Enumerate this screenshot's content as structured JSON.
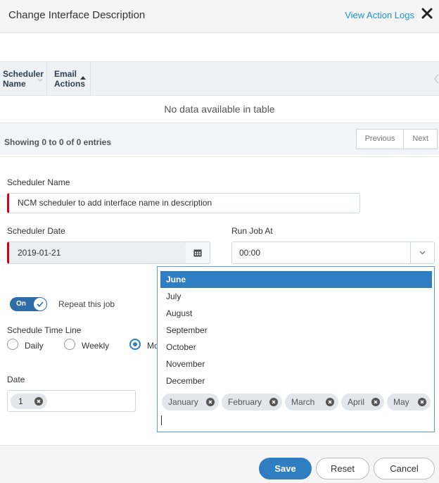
{
  "header": {
    "title": "Change Interface Description",
    "view_logs": "View Action Logs"
  },
  "table": {
    "columns": [
      {
        "line1": "Scheduler",
        "line2": "Name"
      },
      {
        "line1": "Email",
        "line2": "Actions"
      }
    ],
    "empty_message": "No data available in table",
    "info": "Showing 0 to 0 of 0 entries",
    "prev_label": "Previous",
    "next_label": "Next"
  },
  "form": {
    "scheduler_name_label": "Scheduler Name",
    "scheduler_name_value": "NCM scheduler to add interface name in description",
    "scheduler_date_label": "Scheduler Date",
    "scheduler_date_value": "2019-01-21",
    "run_job_label": "Run Job At",
    "run_job_value": "00:00",
    "repeat_toggle_label": "On",
    "repeat_label": "Repeat this job",
    "timeline_label": "Schedule Time Line",
    "timeline_options": [
      "Daily",
      "Weekly",
      "Mo"
    ],
    "timeline_selected": "Monthly",
    "date_label": "Date",
    "date_value": "1"
  },
  "dropdown": {
    "options": [
      "June",
      "July",
      "August",
      "September",
      "October",
      "November",
      "December"
    ],
    "highlighted": "June",
    "selected_chips": [
      "January",
      "February",
      "March",
      "April",
      "May"
    ]
  },
  "footer": {
    "save": "Save",
    "reset": "Reset",
    "cancel": "Cancel"
  },
  "colors": {
    "accent": "#2f7ec2",
    "link": "#1e90d6",
    "required": "#d0021b"
  }
}
